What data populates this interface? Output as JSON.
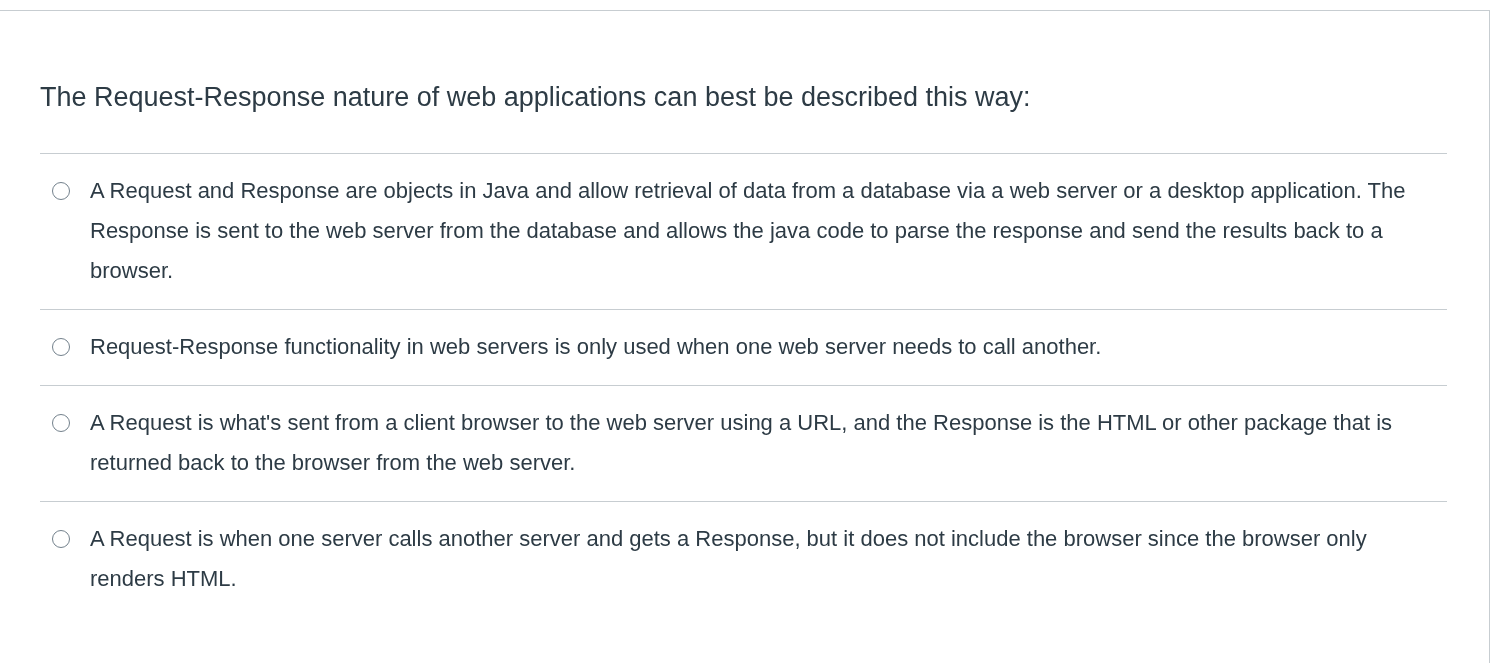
{
  "question": {
    "text": "The Request-Response nature of web applications can best be described this way:"
  },
  "answers": [
    {
      "text": "A Request and Response are objects in Java and allow retrieval of data from a database via a web server or a desktop application.  The Response is sent to the web server from the database and allows the java code to parse the response and send the results back to a browser.",
      "selected": false
    },
    {
      "text": "Request-Response functionality in web servers is only used when one web server needs to call another.",
      "selected": false
    },
    {
      "text": "A Request is what's sent from a client browser to the web server using a URL, and the Response is the HTML or other package that is returned back to the browser from the web server.",
      "selected": false
    },
    {
      "text": "A Request is when one server calls another server and gets a Response, but it does not include the browser since the browser only renders HTML.",
      "selected": false
    }
  ]
}
